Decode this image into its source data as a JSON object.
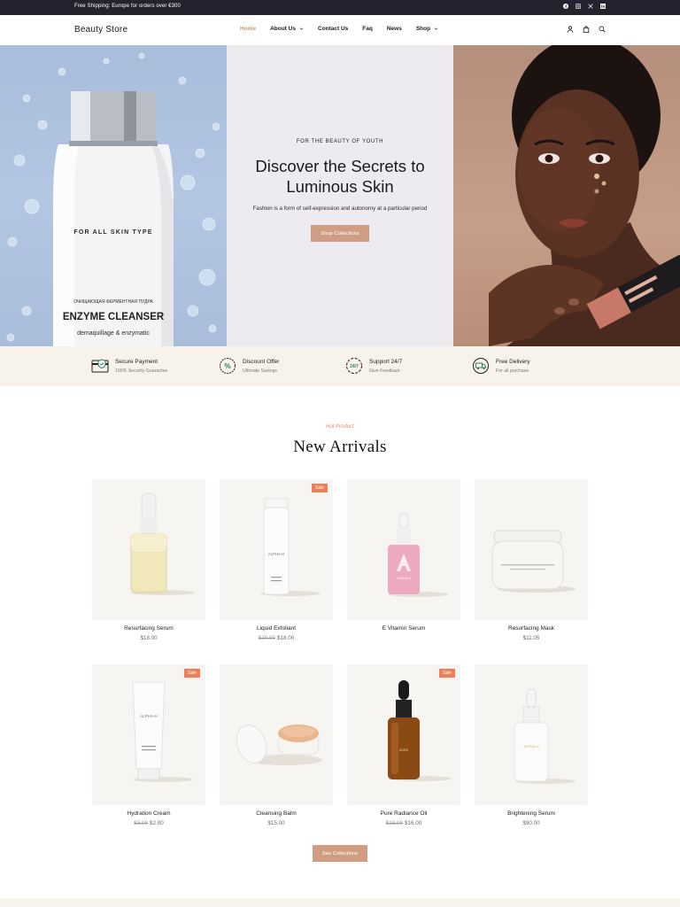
{
  "topbar": {
    "shipping_text": "Free Shipping: Europe for orders over €300",
    "social_icons": [
      "facebook-icon",
      "instagram-icon",
      "x-icon",
      "linkedin-icon"
    ]
  },
  "header": {
    "logo": "Beauty Store",
    "nav": [
      {
        "label": "Home",
        "active": true,
        "has_dropdown": false
      },
      {
        "label": "About Us",
        "active": false,
        "has_dropdown": true
      },
      {
        "label": "Contact Us",
        "active": false,
        "has_dropdown": false
      },
      {
        "label": "Faq",
        "active": false,
        "has_dropdown": false
      },
      {
        "label": "News",
        "active": false,
        "has_dropdown": false
      },
      {
        "label": "Shop",
        "active": false,
        "has_dropdown": true
      }
    ],
    "icons": [
      "user-icon",
      "bag-icon",
      "search-icon"
    ]
  },
  "hero": {
    "eyebrow": "FOR THE BEAUTY OF YOUTH",
    "title_line1": "Discover the Secrets to",
    "title_line2": "Luminous Skin",
    "subtitle": "Fashion is a form of self-expression and autonomy at a particular period",
    "button": "Shop Collections",
    "left_bottle": {
      "tagline": "FOR ALL SKIN TYPE",
      "cyrillic": "ОЧИЩАЮЩАЯ ФЕРМЕНТНАЯ ПУДРА",
      "name": "ENZYME CLEANSER",
      "sub": "demaquillage & enzymatic"
    }
  },
  "features": [
    {
      "title": "Secure Payment",
      "subtitle": "100% Security Guarantee",
      "icon": "secure-payment-icon"
    },
    {
      "title": "Discount Offer",
      "subtitle": "Ultimate Savings",
      "icon": "discount-icon"
    },
    {
      "title": "Support 24/7",
      "subtitle": "Give Feedback",
      "icon": "support-icon"
    },
    {
      "title": "Free Delivery",
      "subtitle": "For all purchase",
      "icon": "delivery-icon"
    }
  ],
  "arrivals": {
    "eyebrow": "Hot Product",
    "title": "New Arrivals",
    "sale_label": "Sale",
    "products": [
      {
        "name": "Resurfacing Serum",
        "old_price": "",
        "price": "$18.00",
        "sale": false
      },
      {
        "name": "Liquid Exfoliant",
        "old_price": "$20.00",
        "price": "$18.00",
        "sale": true
      },
      {
        "name": "E Vitamin Serum",
        "old_price": "",
        "price": "",
        "sale": false
      },
      {
        "name": "Resurfacing Mask",
        "old_price": "",
        "price": "$11.05",
        "sale": false
      },
      {
        "name": "Hydration Cream",
        "old_price": "$3.00",
        "price": "$2.00",
        "sale": true
      },
      {
        "name": "Cleansing Balm",
        "old_price": "",
        "price": "$15.00",
        "sale": false
      },
      {
        "name": "Pure Radiance Oil",
        "old_price": "$18.00",
        "price": "$16.00",
        "sale": true
      },
      {
        "name": "Brightening Serum",
        "old_price": "",
        "price": "$90.00",
        "sale": false
      }
    ],
    "button": "See Collections"
  },
  "colors": {
    "accent": "#cf9e82",
    "nav_active": "#d4936d",
    "sale_badge": "#ee7f58",
    "topbar": "#23232f",
    "feature_bg": "#f7f2ea"
  }
}
